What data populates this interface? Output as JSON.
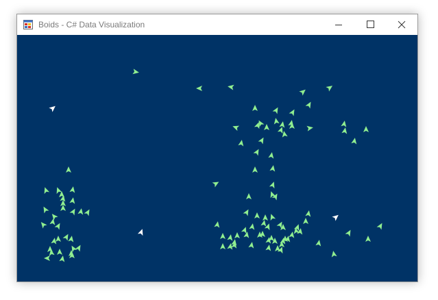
{
  "window": {
    "title": "Boids - C# Data Visualization"
  },
  "colors": {
    "canvas_background": "#003366",
    "boid": "#90ee90",
    "predator": "#ffffff"
  },
  "icons": {
    "app": "app-form-icon",
    "minimize": "minimize-icon",
    "maximize": "maximize-icon",
    "close": "close-icon"
  }
}
